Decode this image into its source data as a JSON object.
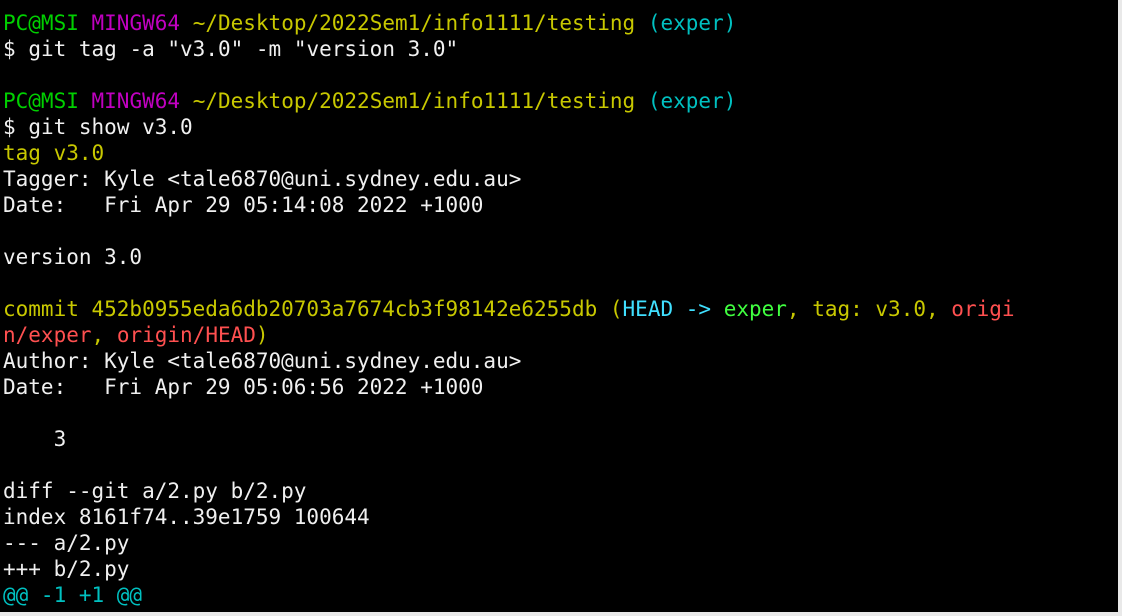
{
  "prompt": {
    "user_host": "PC@MSI",
    "system": "MINGW64",
    "path": "~/Desktop/2022Sem1/info1111/testing",
    "branch": "(exper)",
    "dollar": "$"
  },
  "commands": {
    "tag_cmd": "git tag -a \"v3.0\" -m \"version 3.0\"",
    "show_cmd": "git show v3.0"
  },
  "tag": {
    "header": "tag v3.0",
    "tagger": "Tagger: Kyle <tale6870@uni.sydney.edu.au>",
    "date": "Date:   Fri Apr 29 05:14:08 2022 +1000",
    "message": "version 3.0"
  },
  "commit": {
    "prefix": "commit 452b0955eda6db20703a7674cb3f98142e6255db ",
    "open_paren": "(",
    "head": "HEAD -> ",
    "branch": "exper",
    "sep1": ", ",
    "tag_label": "tag: v3.0",
    "sep2": ", ",
    "origin_part1": "origi",
    "origin_part2": "n/exper",
    "sep3": ", ",
    "origin_head": "origin/HEAD",
    "close_paren": ")",
    "author": "Author: Kyle <tale6870@uni.sydney.edu.au>",
    "date": "Date:   Fri Apr 29 05:06:56 2022 +1000",
    "message": "    3"
  },
  "diff": {
    "header": "diff --git a/2.py b/2.py",
    "index": "index 8161f74..39e1759 100644",
    "minus": "--- a/2.py",
    "plus": "+++ b/2.py",
    "hunk": "@@ -1 +1 @@"
  }
}
